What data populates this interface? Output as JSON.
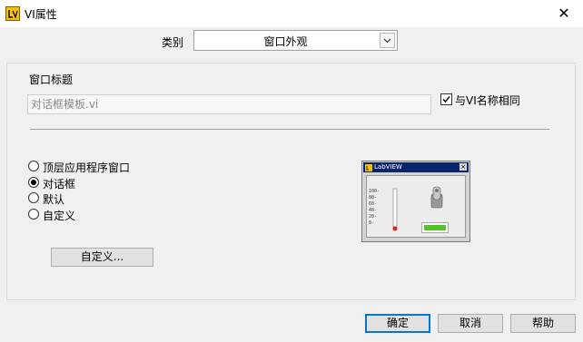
{
  "window": {
    "title": "VI属性",
    "close_glyph": "✕"
  },
  "category": {
    "label": "类别",
    "selected": "窗口外观"
  },
  "window_title_section": {
    "label": "窗口标题",
    "input_value": "对话框模板.vi",
    "same_as_vi_label": "与VI名称相同",
    "same_as_vi_checked": true
  },
  "appearance_options": [
    {
      "label": "顶层应用程序窗口",
      "selected": false
    },
    {
      "label": "对话框",
      "selected": true
    },
    {
      "label": "默认",
      "selected": false
    },
    {
      "label": "自定义",
      "selected": false
    }
  ],
  "customize_button": "自定义...",
  "preview": {
    "title": "LabVIEW",
    "scale_ticks": [
      "100-",
      "80-",
      "60-",
      "40-",
      "20-",
      "0-"
    ]
  },
  "footer": {
    "ok": "确定",
    "cancel": "取消",
    "help": "帮助"
  }
}
